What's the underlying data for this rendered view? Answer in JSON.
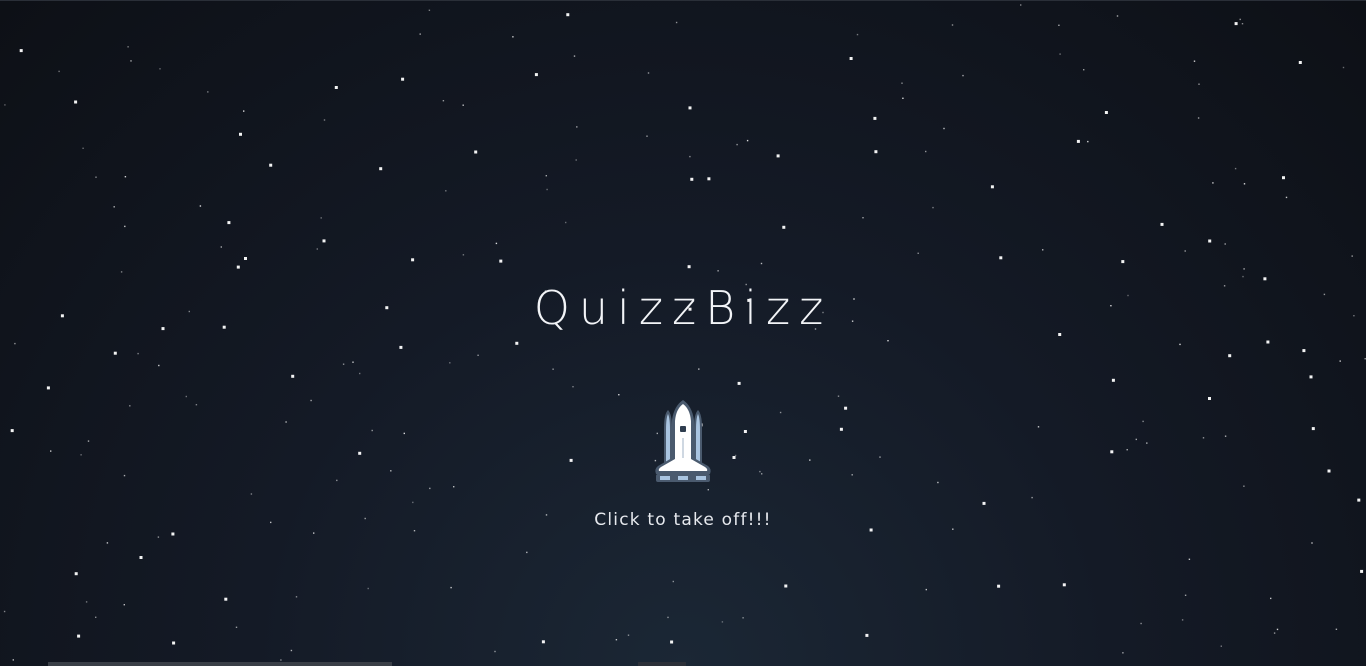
{
  "app": {
    "title": "QuizzBizz"
  },
  "launch": {
    "icon": "rocket-icon",
    "label": "Click to take off!!!"
  },
  "colors": {
    "background_center": "#1b2735",
    "background_edge": "#0d1016",
    "star": "#ffffff",
    "title_text": "#f2f4f7",
    "rocket_body": "#ffffff",
    "rocket_outline": "#4a5a6e",
    "rocket_accent": "#a9c4e0"
  }
}
